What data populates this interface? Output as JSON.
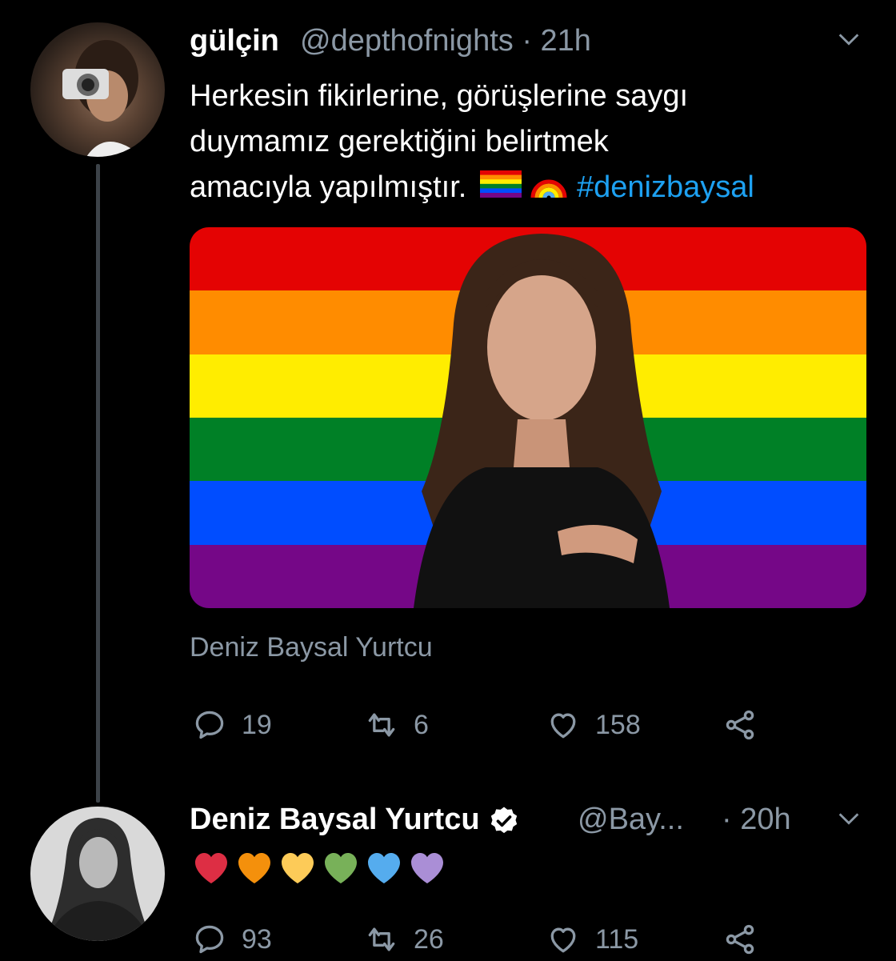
{
  "tweet1": {
    "display_name": "gülçin",
    "handle_time": "@depthofnights · 21h",
    "text_line1": "Herkesin fikirlerine, görüşlerine saygı",
    "text_line2": "duymamız gerektiğini belirtmek",
    "text_line3": "amacıyla yapılmıştır.",
    "hashtag": "#denizbaysal",
    "media_caption": "Deniz Baysal Yurtcu",
    "replies": "19",
    "retweets": "6",
    "likes": "158"
  },
  "tweet2": {
    "display_name": "Deniz Baysal Yurtcu",
    "handle": "@Bay...",
    "time": "· 20h",
    "replies": "93",
    "retweets": "26",
    "likes": "115"
  },
  "colors": {
    "background": "#000000",
    "muted": "#8b98a5",
    "link": "#1da1f2",
    "thread_line": "#3d4349"
  },
  "flag_colors": [
    "#e40303",
    "#ff8c00",
    "#ffed00",
    "#008026",
    "#004dff",
    "#750787"
  ],
  "heart_colors": [
    "#dd2e44",
    "#f4900c",
    "#fdcb58",
    "#78b159",
    "#55acee",
    "#aa8ed6"
  ],
  "icons": [
    "chevron-down-icon",
    "reply-icon",
    "retweet-icon",
    "like-icon",
    "share-icon",
    "verified-icon",
    "pride-flag-emoji",
    "rainbow-emoji"
  ]
}
